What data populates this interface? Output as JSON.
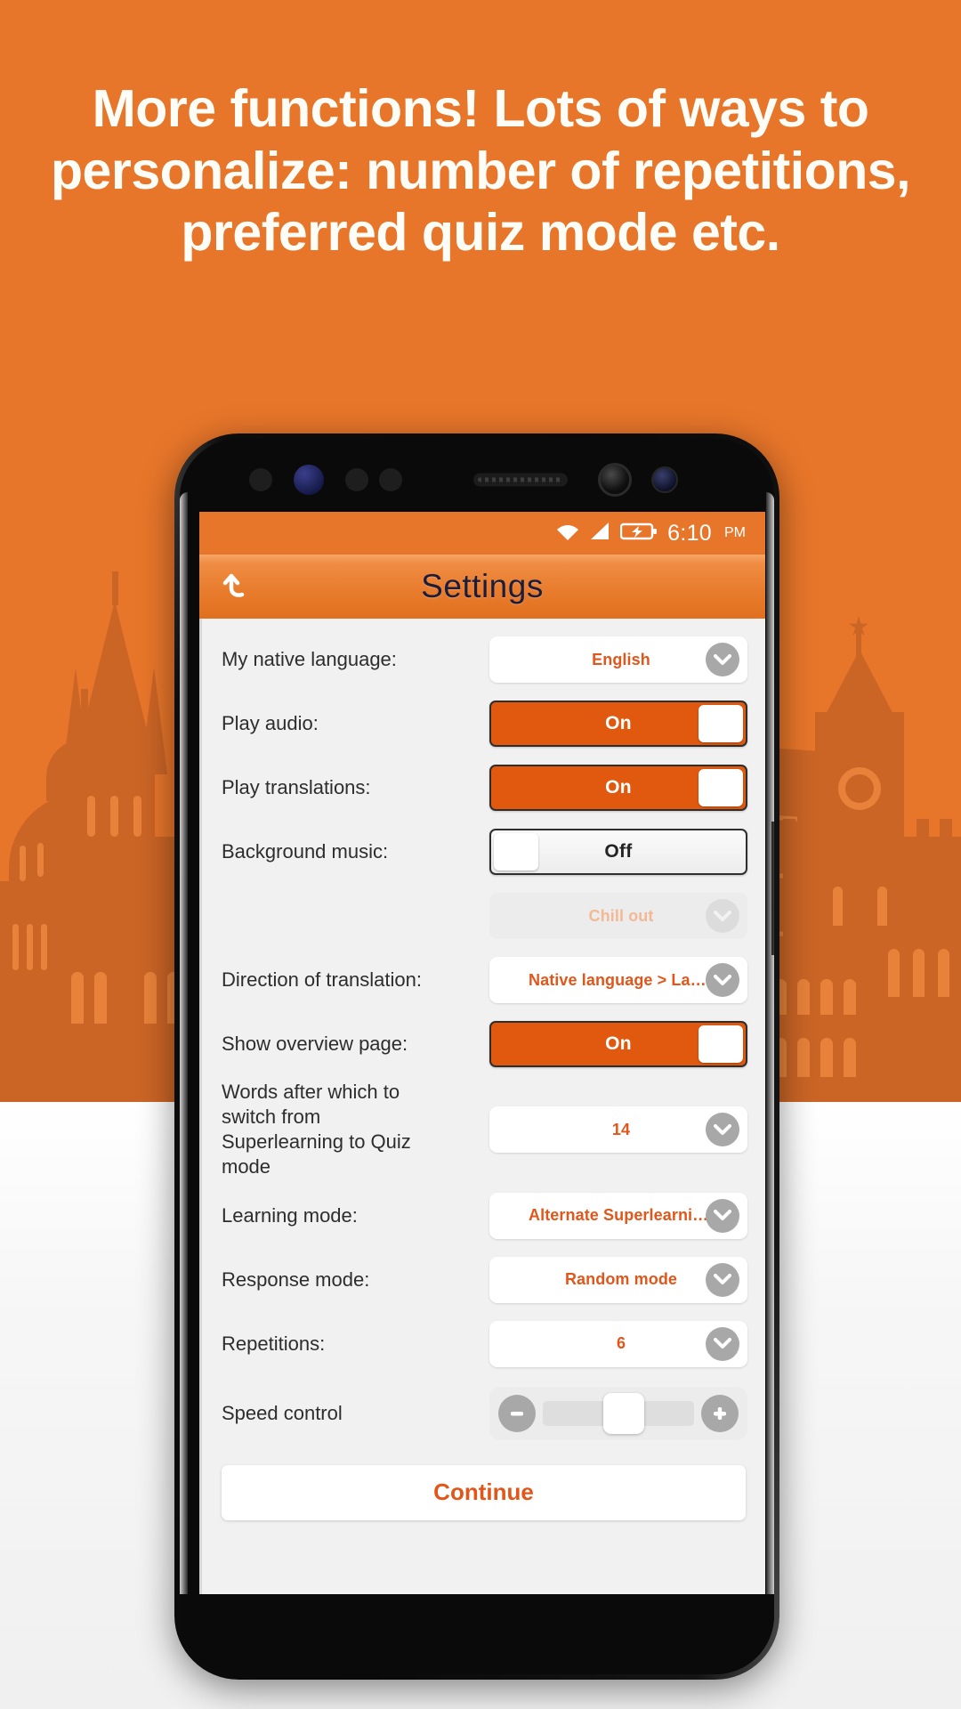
{
  "promo": {
    "headline": "More functions! Lots of ways to personalize: number of repetitions, preferred quiz mode etc."
  },
  "colors": {
    "background_orange": "#e8762a",
    "skyline_silhouette": "#cb6526",
    "accent_orange": "#e2561a",
    "toggle_on": "#e1590f",
    "appbar_title": "#1d1d3a"
  },
  "phone": {
    "status_bar": {
      "wifi": "wifi-icon",
      "signal": "signal-icon",
      "battery": "battery-charging-icon",
      "time": "6:10",
      "meridiem": "PM"
    },
    "app_bar": {
      "back": "back-arrow-icon",
      "title": "Settings"
    },
    "settings": {
      "rows": [
        {
          "label": "My native language:",
          "type": "dropdown",
          "value": "English",
          "state": "enabled"
        },
        {
          "label": "Play audio:",
          "type": "toggle",
          "value": "On",
          "state": "on"
        },
        {
          "label": "Play translations:",
          "type": "toggle",
          "value": "On",
          "state": "on"
        },
        {
          "label": "Background music:",
          "type": "toggle",
          "value": "Off",
          "state": "off"
        },
        {
          "label": "",
          "type": "dropdown",
          "value": "Chill out",
          "state": "disabled"
        },
        {
          "label": "Direction of translation:",
          "type": "dropdown",
          "value": "Native language > Language ...",
          "state": "enabled"
        },
        {
          "label": "Show overview page:",
          "type": "toggle",
          "value": "On",
          "state": "on"
        },
        {
          "label": "Words after which to switch from Superlearning to Quiz mode",
          "type": "dropdown",
          "value": "14",
          "state": "enabled"
        },
        {
          "label": "Learning mode:",
          "type": "dropdown",
          "value": "Alternate Superlearning and ...",
          "state": "enabled"
        },
        {
          "label": "Response mode:",
          "type": "dropdown",
          "value": "Random mode",
          "state": "enabled"
        },
        {
          "label": "Repetitions:",
          "type": "dropdown",
          "value": "6",
          "state": "enabled"
        },
        {
          "label": "Speed control",
          "type": "slider",
          "minus": "minus-icon",
          "plus": "plus-icon",
          "position_percent": 40
        }
      ],
      "continue_label": "Continue"
    }
  }
}
